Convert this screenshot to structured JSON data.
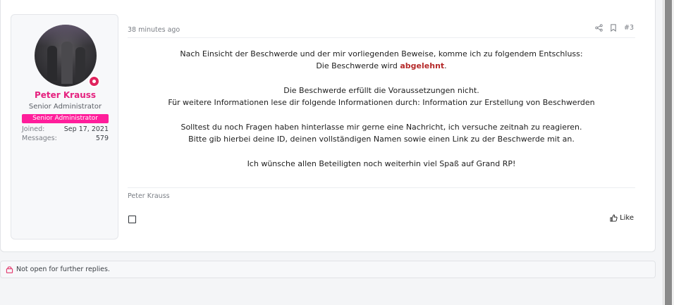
{
  "user": {
    "name": "Peter Krauss",
    "title": "Senior Administrator",
    "banner": "Senior Administrator",
    "joined_label": "Joined:",
    "joined_value": "Sep 17, 2021",
    "messages_label": "Messages:",
    "messages_value": "579"
  },
  "post": {
    "date": "38 minutes ago",
    "number": "#3",
    "line1": "Nach Einsicht der Beschwerde und der mir vorliegenden Beweise, komme ich zu folgendem Entschluss:",
    "line2_prefix": "Die Beschwerde wird ",
    "line2_highlight": "abgelehnt",
    "line2_suffix": ".",
    "line3": "Die Beschwerde erfüllt die Voraussetzungen nicht.",
    "line4": "Für weitere Informationen lese dir folgende Informationen durch: Information zur Erstellung von Beschwerden",
    "line5": "Solltest du noch Fragen haben hinterlasse mir gerne eine Nachricht, ich versuche zeitnah zu reagieren.",
    "line6": "Bitte gib hierbei deine ID, deinen vollständigen Namen sowie einen Link zu der Beschwerde mit an.",
    "line7": "Ich wünsche allen Beteiligten noch weiterhin viel Spaß auf Grand RP!",
    "signature": "Peter Krauss",
    "like_label": "Like"
  },
  "notice": {
    "text": "Not open for further replies."
  },
  "colors": {
    "username": "#e5217f",
    "banner": "#ff1e9b",
    "rejected": "#b52a2a",
    "lock_icon": "#e0245e"
  },
  "icons": {
    "share": "share-icon",
    "bookmark": "bookmark-icon",
    "like": "thumbs-up-icon",
    "lock": "lock-icon",
    "online": "online-status-icon"
  }
}
